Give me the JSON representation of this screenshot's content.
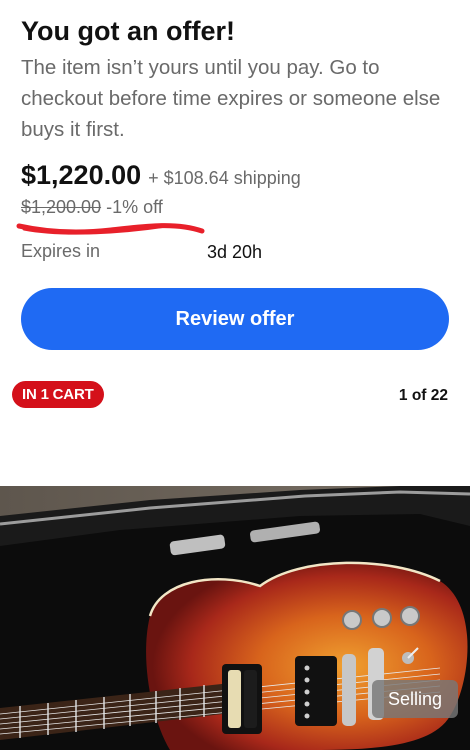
{
  "offer": {
    "title": "You got an offer!",
    "description": "The item isn’t yours until you pay. Go to checkout before time expires or someone else buys it first.",
    "price": "$1,220.00",
    "shipping": "+ $108.64 shipping",
    "original_price": "$1,200.00",
    "discount": "-1% off",
    "expires_label": "Expires in",
    "expires_value": "3d 20h"
  },
  "actions": {
    "review_label": "Review offer"
  },
  "listing": {
    "cart_badge": "IN 1 CART",
    "image_counter": "1 of 22",
    "selling_label": "Selling"
  },
  "colors": {
    "primary_button": "#1f6af3",
    "badge_red": "#d4101a",
    "annotation_red": "#e8202a"
  }
}
